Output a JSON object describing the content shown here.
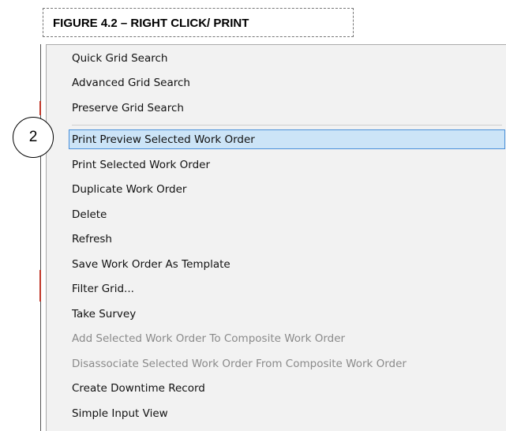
{
  "figure": {
    "caption": "FIGURE 4.2 – RIGHT CLICK/ PRINT"
  },
  "callout": {
    "label": "2"
  },
  "context_menu": {
    "items": [
      {
        "label": "Quick Grid Search",
        "enabled": true
      },
      {
        "label": "Advanced Grid Search",
        "enabled": true
      },
      {
        "label": "Preserve Grid Search",
        "enabled": true
      },
      {
        "label": "Print Preview Selected Work Order",
        "enabled": true,
        "highlighted": true
      },
      {
        "label": "Print Selected Work Order",
        "enabled": true
      },
      {
        "label": "Duplicate Work Order",
        "enabled": true
      },
      {
        "label": "Delete",
        "enabled": true
      },
      {
        "label": "Refresh",
        "enabled": true
      },
      {
        "label": "Save Work Order As Template",
        "enabled": true
      },
      {
        "label": "Filter Grid...",
        "enabled": true
      },
      {
        "label": "Take Survey",
        "enabled": true
      },
      {
        "label": "Add Selected Work Order To Composite Work Order",
        "enabled": false
      },
      {
        "label": "Disassociate Selected Work Order From Composite Work Order",
        "enabled": false
      },
      {
        "label": "Create Downtime Record",
        "enabled": true
      },
      {
        "label": "Simple Input View",
        "enabled": true
      }
    ]
  },
  "colors": {
    "menu_background": "#f2f2f2",
    "highlight_fill": "#cce4f7",
    "highlight_border": "#4a90d9",
    "disabled_text": "#8a8a8a"
  }
}
